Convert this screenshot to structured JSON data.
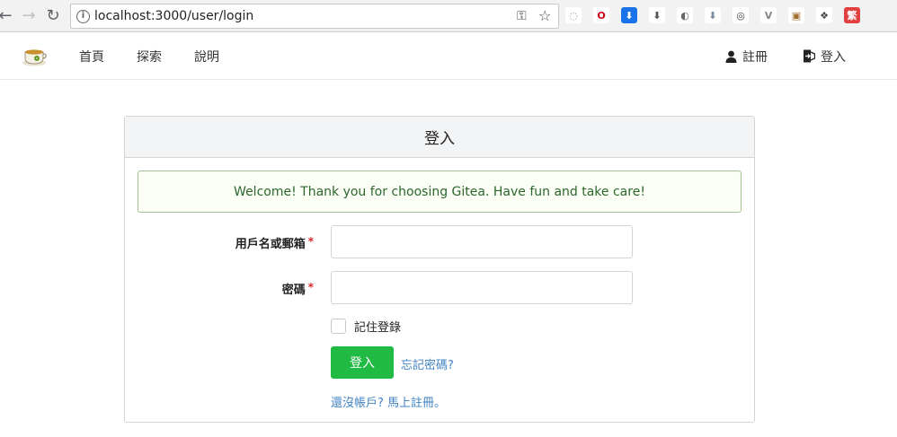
{
  "browser": {
    "url": "localhost:3000/user/login",
    "extensions": [
      {
        "name": "ext-speed-dial-icon",
        "glyph": "◌",
        "bg": "#ffffff",
        "fg": "#999999"
      },
      {
        "name": "ext-opera-icon",
        "glyph": "O",
        "bg": "#ffffff",
        "fg": "#d0021b"
      },
      {
        "name": "ext-blue-download-icon",
        "glyph": "⬇",
        "bg": "#1a73e8",
        "fg": "#ffffff"
      },
      {
        "name": "ext-download-box-icon",
        "glyph": "⬇",
        "bg": "#ffffff",
        "fg": "#555555"
      },
      {
        "name": "ext-grey-circle-icon",
        "glyph": "◐",
        "bg": "#ffffff",
        "fg": "#666666"
      },
      {
        "name": "ext-arrow-down-icon",
        "glyph": "⬇",
        "bg": "#ffffff",
        "fg": "#7a8aa0"
      },
      {
        "name": "ext-www-icon",
        "glyph": "◎",
        "bg": "#ffffff",
        "fg": "#444444"
      },
      {
        "name": "ext-vue-icon",
        "glyph": "V",
        "bg": "#ffffff",
        "fg": "#888888"
      },
      {
        "name": "ext-image-icon",
        "glyph": "▣",
        "bg": "#ffffff",
        "fg": "#a07030"
      },
      {
        "name": "ext-evernote-icon",
        "glyph": "❖",
        "bg": "#ffffff",
        "fg": "#444444"
      },
      {
        "name": "ext-traditional-chinese-icon",
        "glyph": "繁",
        "bg": "#e04040",
        "fg": "#ffffff"
      }
    ]
  },
  "header": {
    "menu": {
      "home": "首頁",
      "explore": "探索",
      "help": "說明"
    },
    "register": "註冊",
    "signin": "登入"
  },
  "login": {
    "title": "登入",
    "flash": "Welcome! Thank you for choosing Gitea. Have fun and take care!",
    "username_label": "用戶名或郵箱",
    "password_label": "密碼",
    "required_mark": "*",
    "remember_label": "記住登錄",
    "submit_label": "登入",
    "forgot_link": "忘記密碼?",
    "signup_link": "還沒帳戶? 馬上註冊。"
  },
  "colors": {
    "primary_button": "#21ba45",
    "link": "#4183c4",
    "flash_bg": "#fcfff5",
    "flash_border": "#a3c293",
    "flash_text": "#2c662d"
  }
}
